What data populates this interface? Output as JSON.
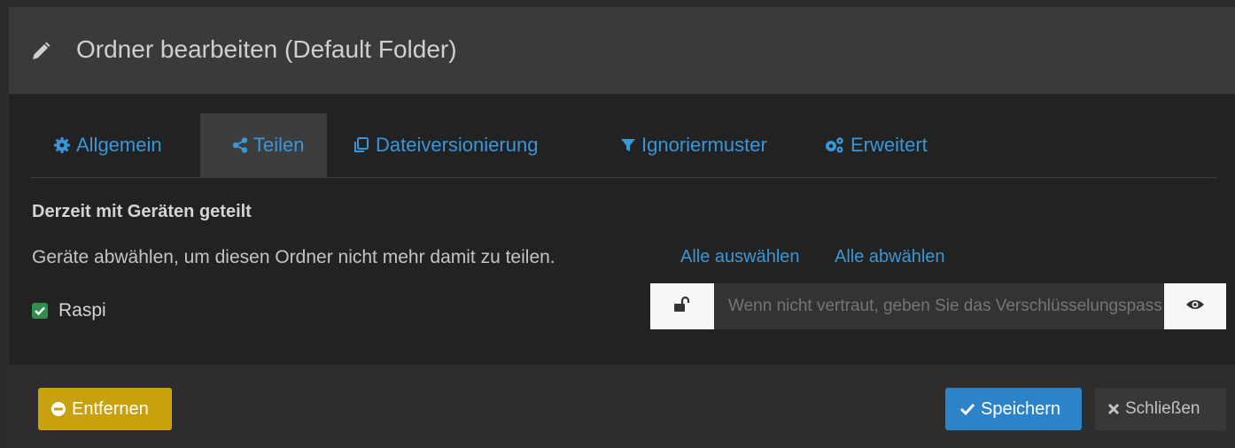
{
  "header": {
    "title": "Ordner bearbeiten (Default Folder)",
    "icon": "pencil-icon"
  },
  "tabs": [
    {
      "label": "Allgemein",
      "icon": "gear-icon"
    },
    {
      "label": "Teilen",
      "icon": "share-icon"
    },
    {
      "label": "Dateiversionierung",
      "icon": "copy-icon"
    },
    {
      "label": "Ignoriermuster",
      "icon": "filter-icon"
    },
    {
      "label": "Erweitert",
      "icon": "gears-icon"
    }
  ],
  "active_tab": "Teilen",
  "sharing": {
    "section_title": "Derzeit mit Geräten geteilt",
    "description": "Geräte abwählen, um diesen Ordner nicht mehr damit zu teilen.",
    "select_all": "Alle auswählen",
    "deselect_all": "Alle abwählen",
    "device_name": "Raspi",
    "device_checked": true,
    "password_placeholder": "Wenn nicht vertraut, geben Sie das Verschlüsselungspasswort ein"
  },
  "footer": {
    "remove_label": "Entfernen",
    "save_label": "Speichern",
    "close_label": "Schließen"
  },
  "colors": {
    "link": "#3a96d6",
    "remove": "#c9a00e",
    "save": "#2c83c8",
    "checkbox": "#2f8f4a"
  }
}
